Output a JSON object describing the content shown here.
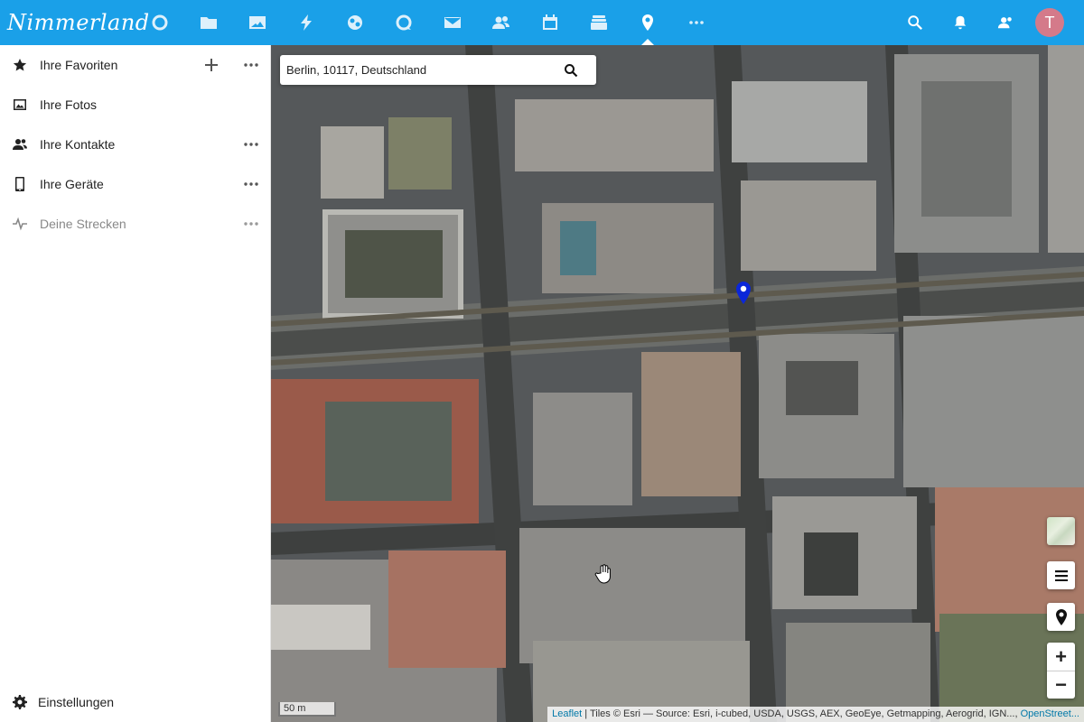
{
  "header": {
    "logo_text": "Nimmerland",
    "apps": [
      {
        "name": "dashboard-icon"
      },
      {
        "name": "files-icon"
      },
      {
        "name": "photos-icon"
      },
      {
        "name": "activity-icon"
      },
      {
        "name": "circles-icon"
      },
      {
        "name": "talk-icon"
      },
      {
        "name": "mail-icon"
      },
      {
        "name": "contacts-icon"
      },
      {
        "name": "calendar-icon"
      },
      {
        "name": "deck-icon"
      },
      {
        "name": "maps-icon",
        "active": true
      },
      {
        "name": "more-apps-icon"
      }
    ],
    "avatar_letter": "T",
    "accent_color": "#1aa0e8"
  },
  "sidebar": {
    "items": [
      {
        "label": "Ihre Favoriten",
        "icon": "star-icon"
      },
      {
        "label": "Ihre Fotos",
        "icon": "image-icon"
      },
      {
        "label": "Ihre Kontakte",
        "icon": "contacts-icon"
      },
      {
        "label": "Ihre Geräte",
        "icon": "phone-icon"
      },
      {
        "label": "Deine Strecken",
        "icon": "track-icon"
      }
    ],
    "settings_label": "Einstellungen"
  },
  "map": {
    "search_value": "Berlin, 10117, Deutschland",
    "scale_label": "50 m",
    "attribution_link": "Leaflet",
    "attribution_text": " | Tiles © Esri — Source: Esri, i-cubed, USDA, USGS, AEX, GeoEye, Getmapping, Aerogrid, IGN..., ",
    "attribution_osm": "OpenStreet...",
    "zoom_in": "+",
    "zoom_out": "−",
    "marker_color": "#0b27d9"
  }
}
